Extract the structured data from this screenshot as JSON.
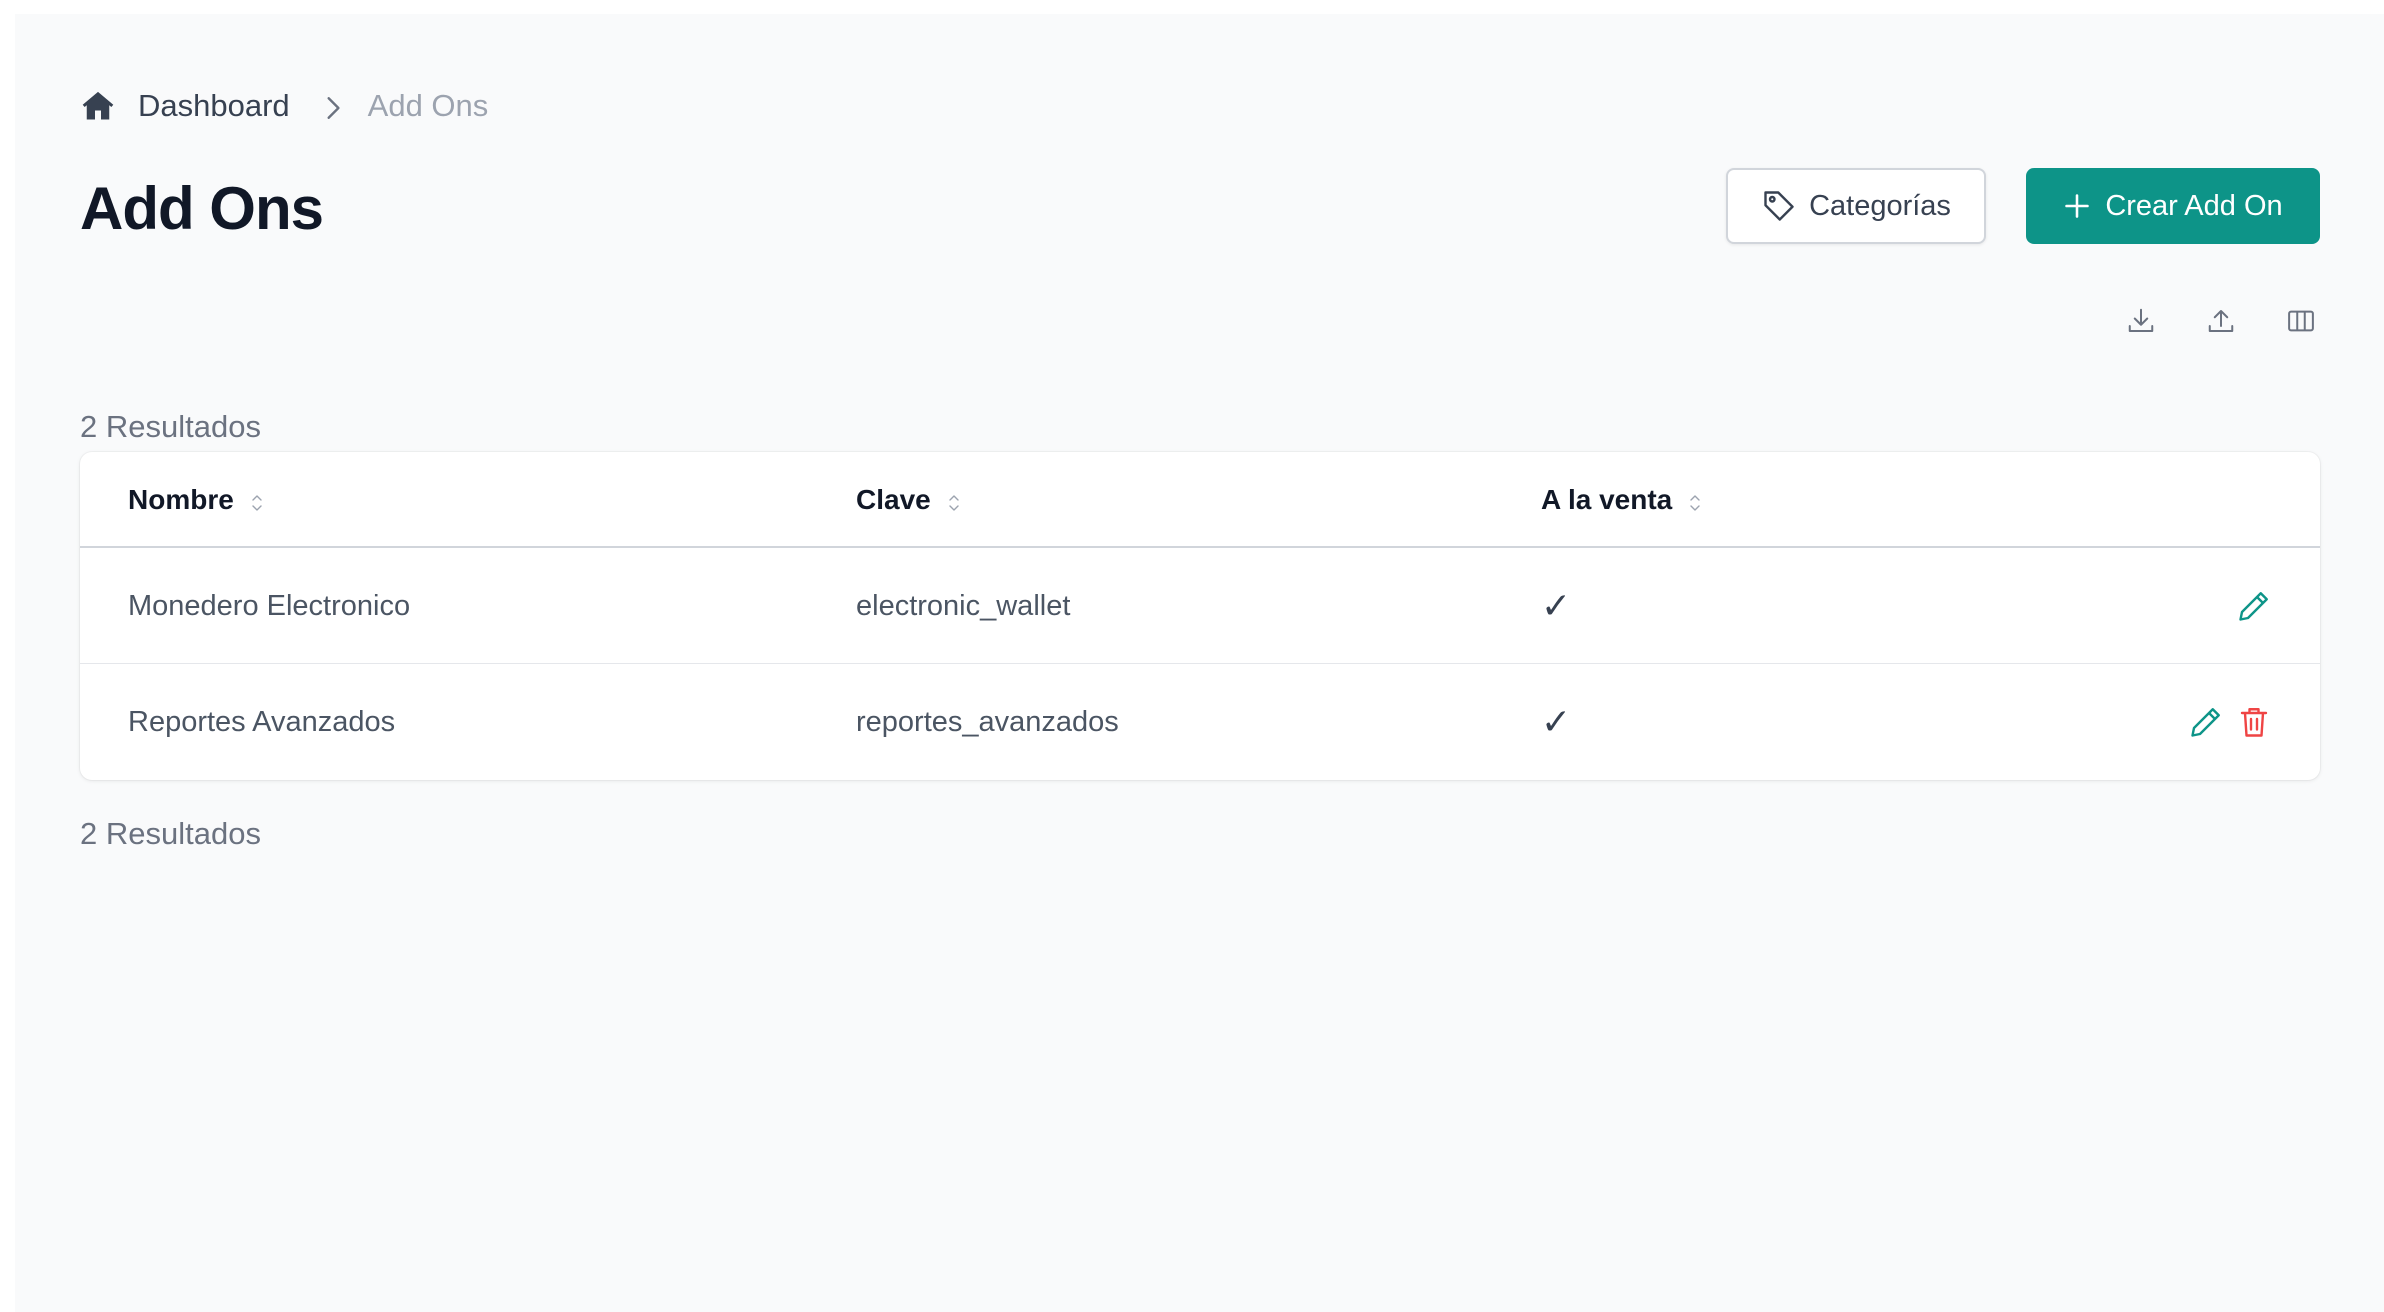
{
  "breadcrumb": {
    "home_icon": "home-icon",
    "items": [
      "Dashboard",
      "Add Ons"
    ]
  },
  "page": {
    "title": "Add Ons"
  },
  "actions": {
    "categorias_label": "Categorías",
    "crear_label": "Crear Add On"
  },
  "toolbar": {
    "icons": [
      "download-icon",
      "upload-icon",
      "columns-icon"
    ]
  },
  "results": {
    "count_label": "2 Resultados"
  },
  "table": {
    "columns": [
      "Nombre",
      "Clave",
      "A la venta"
    ],
    "rows": [
      {
        "nombre": "Monedero Electronico",
        "clave": "electronic_wallet",
        "a_la_venta": "✓",
        "actions": [
          "edit"
        ]
      },
      {
        "nombre": "Reportes Avanzados",
        "clave": "reportes_avanzados",
        "a_la_venta": "✓",
        "actions": [
          "edit",
          "delete"
        ]
      }
    ]
  },
  "colors": {
    "primary": "#0d9488",
    "danger": "#ef4444",
    "background": "#f9fafb"
  }
}
